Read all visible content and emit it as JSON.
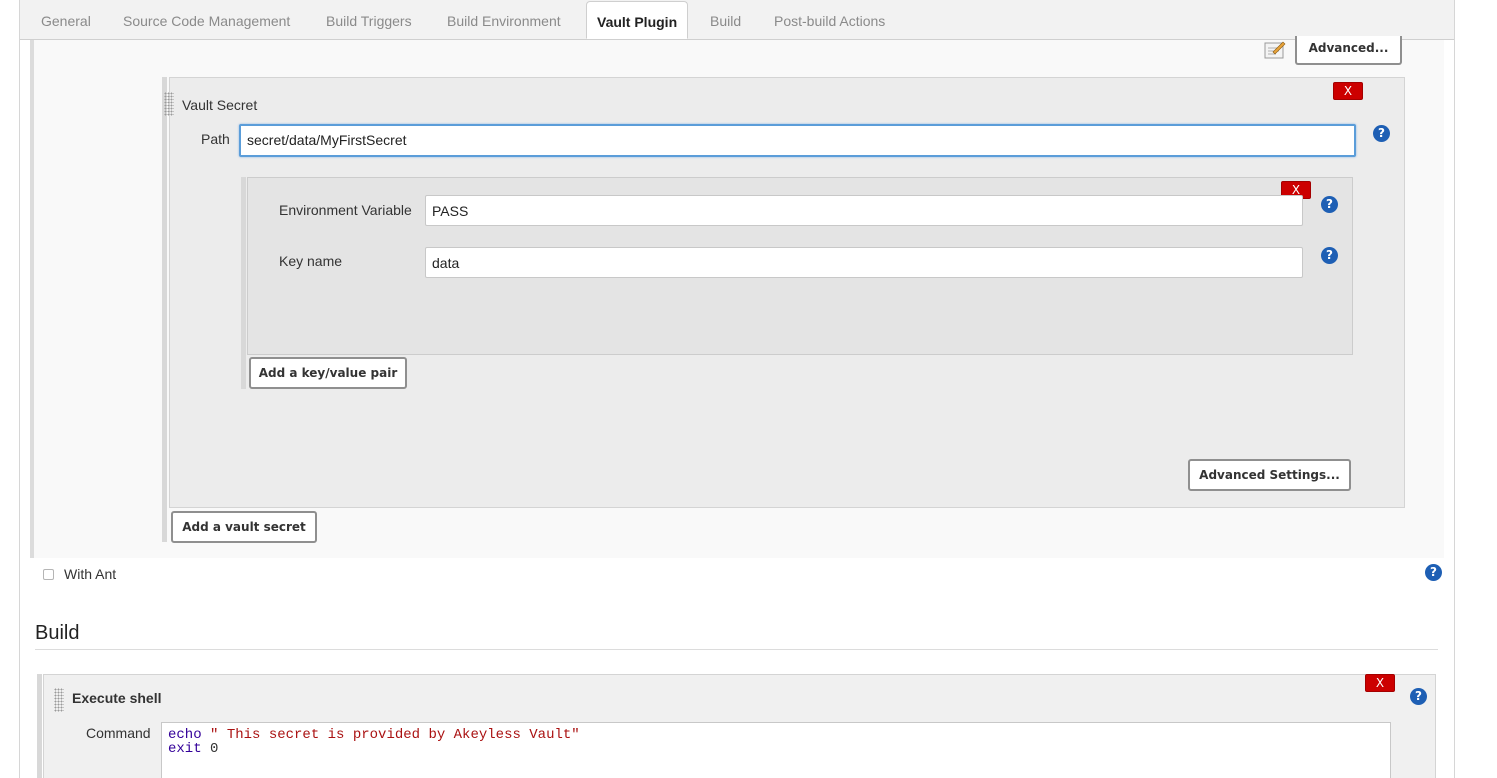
{
  "tabs": [
    {
      "label": "General",
      "active": false
    },
    {
      "label": "Source Code Management",
      "active": false
    },
    {
      "label": "Build Triggers",
      "active": false
    },
    {
      "label": "Build Environment",
      "active": false
    },
    {
      "label": "Vault Plugin",
      "active": true
    },
    {
      "label": "Build",
      "active": false
    },
    {
      "label": "Post-build Actions",
      "active": false
    }
  ],
  "top_advanced_button": "Advanced...",
  "vault_secret": {
    "title": "Vault Secret",
    "delete_label": "X",
    "path_label": "Path",
    "path_value": "secret/data/MyFirstSecret",
    "key_value": {
      "delete_label": "X",
      "env_var_label": "Environment Variable",
      "env_var_value": "PASS",
      "key_name_label": "Key name",
      "key_name_value": "data"
    },
    "add_pair_button": "Add a key/value pair",
    "advanced_settings_button": "Advanced Settings..."
  },
  "add_vault_secret_button": "Add a vault secret",
  "with_ant_label": "With Ant",
  "with_ant_checked": false,
  "build_heading": "Build",
  "execute_shell": {
    "title": "Execute shell",
    "delete_label": "X",
    "command_label": "Command",
    "command_line1_kw": "echo",
    "command_line1_str": "\" This secret is provided by Akeyless Vault\"",
    "command_line2_kw": "exit",
    "command_line2_rest": "0"
  },
  "help_glyph": "?",
  "colors": {
    "delete_red": "#cc0000",
    "help_blue": "#1e5fb4",
    "focus_blue": "#5b9dd9"
  }
}
